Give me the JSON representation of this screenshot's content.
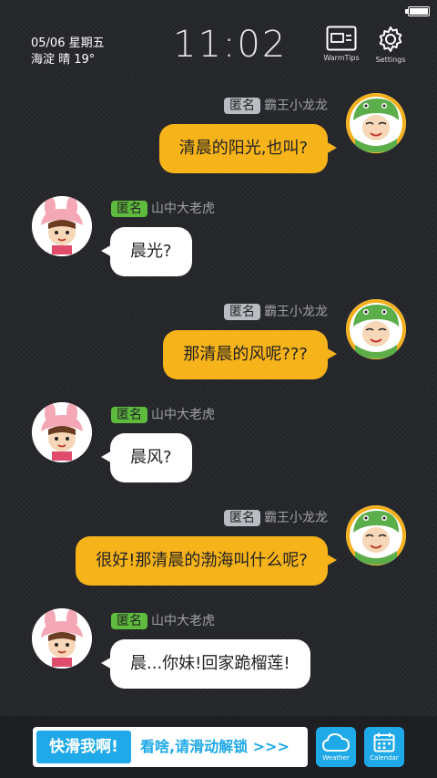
{
  "header": {
    "date": "05/06 星期五",
    "weather": "海淀 晴 19°",
    "time": "11:02",
    "warmtips_label": "WarmTips",
    "settings_label": "Settings"
  },
  "messages": [
    {
      "side": "right",
      "tag": "匿名",
      "name": "霸王小龙龙",
      "text": "清晨的阳光,也叫?"
    },
    {
      "side": "left",
      "tag": "匿名",
      "name": "山中大老虎",
      "text": "晨光?"
    },
    {
      "side": "right",
      "tag": "匿名",
      "name": "霸王小龙龙",
      "text": "那清晨的风呢???"
    },
    {
      "side": "left",
      "tag": "匿名",
      "name": "山中大老虎",
      "text": "晨风?"
    },
    {
      "side": "right",
      "tag": "匿名",
      "name": "霸王小龙龙",
      "text": "很好!那清晨的渤海叫什么呢?"
    },
    {
      "side": "left",
      "tag": "匿名",
      "name": "山中大老虎",
      "text": "晨...你妹!回家跪榴莲!"
    }
  ],
  "bottom": {
    "unlock_button": "快滑我啊!",
    "unlock_hint": "看啥,请滑动解锁 >>>",
    "weather_label": "Weather",
    "calendar_label": "Calendar"
  },
  "colors": {
    "background": "#26272b",
    "bubble_right": "#f6b31a",
    "bubble_left": "#ffffff",
    "tag_green": "#5fbb3e",
    "tag_gray": "#b9bcc2",
    "accent_blue": "#1fa9e8"
  },
  "icons": {
    "warmtips": "warmtips-card-icon",
    "settings": "gear-icon",
    "weather": "cloud-icon",
    "calendar": "calendar-icon",
    "battery": "battery-icon"
  }
}
